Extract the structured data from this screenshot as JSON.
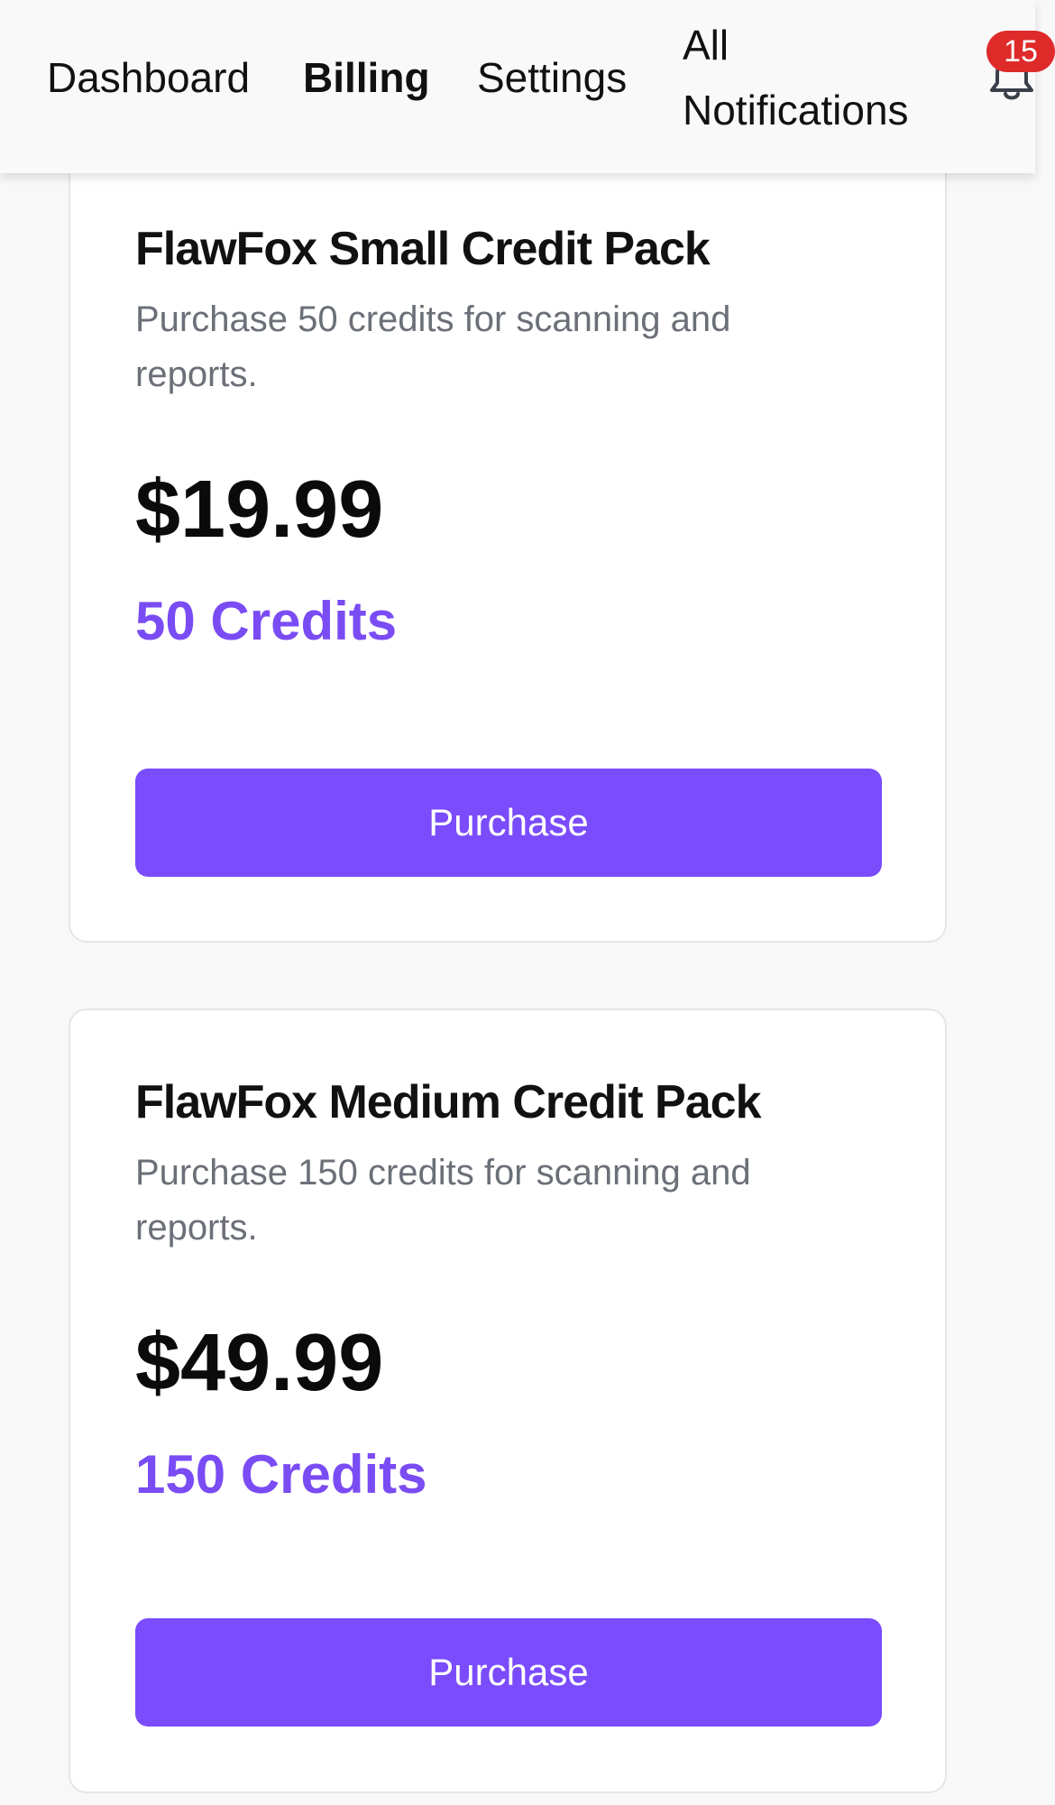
{
  "nav": {
    "items": [
      {
        "label": "Dashboard"
      },
      {
        "label": "Billing"
      },
      {
        "label": "Settings"
      },
      {
        "label": "All Notifications"
      }
    ],
    "notification_count": "15",
    "icon": "bell-icon"
  },
  "packs": [
    {
      "title": "FlawFox Small Credit Pack",
      "description": "Purchase 50 credits for scanning and reports.",
      "price": "$19.99",
      "credits": "50 Credits",
      "button_label": "Purchase"
    },
    {
      "title": "FlawFox Medium Credit Pack",
      "description": "Purchase 150 credits for scanning and reports.",
      "price": "$49.99",
      "credits": "150 Credits",
      "button_label": "Purchase"
    }
  ],
  "colors": {
    "accent": "#7a4cfc",
    "badge": "#df2a2a",
    "credits_text": "#7a4cf4"
  }
}
